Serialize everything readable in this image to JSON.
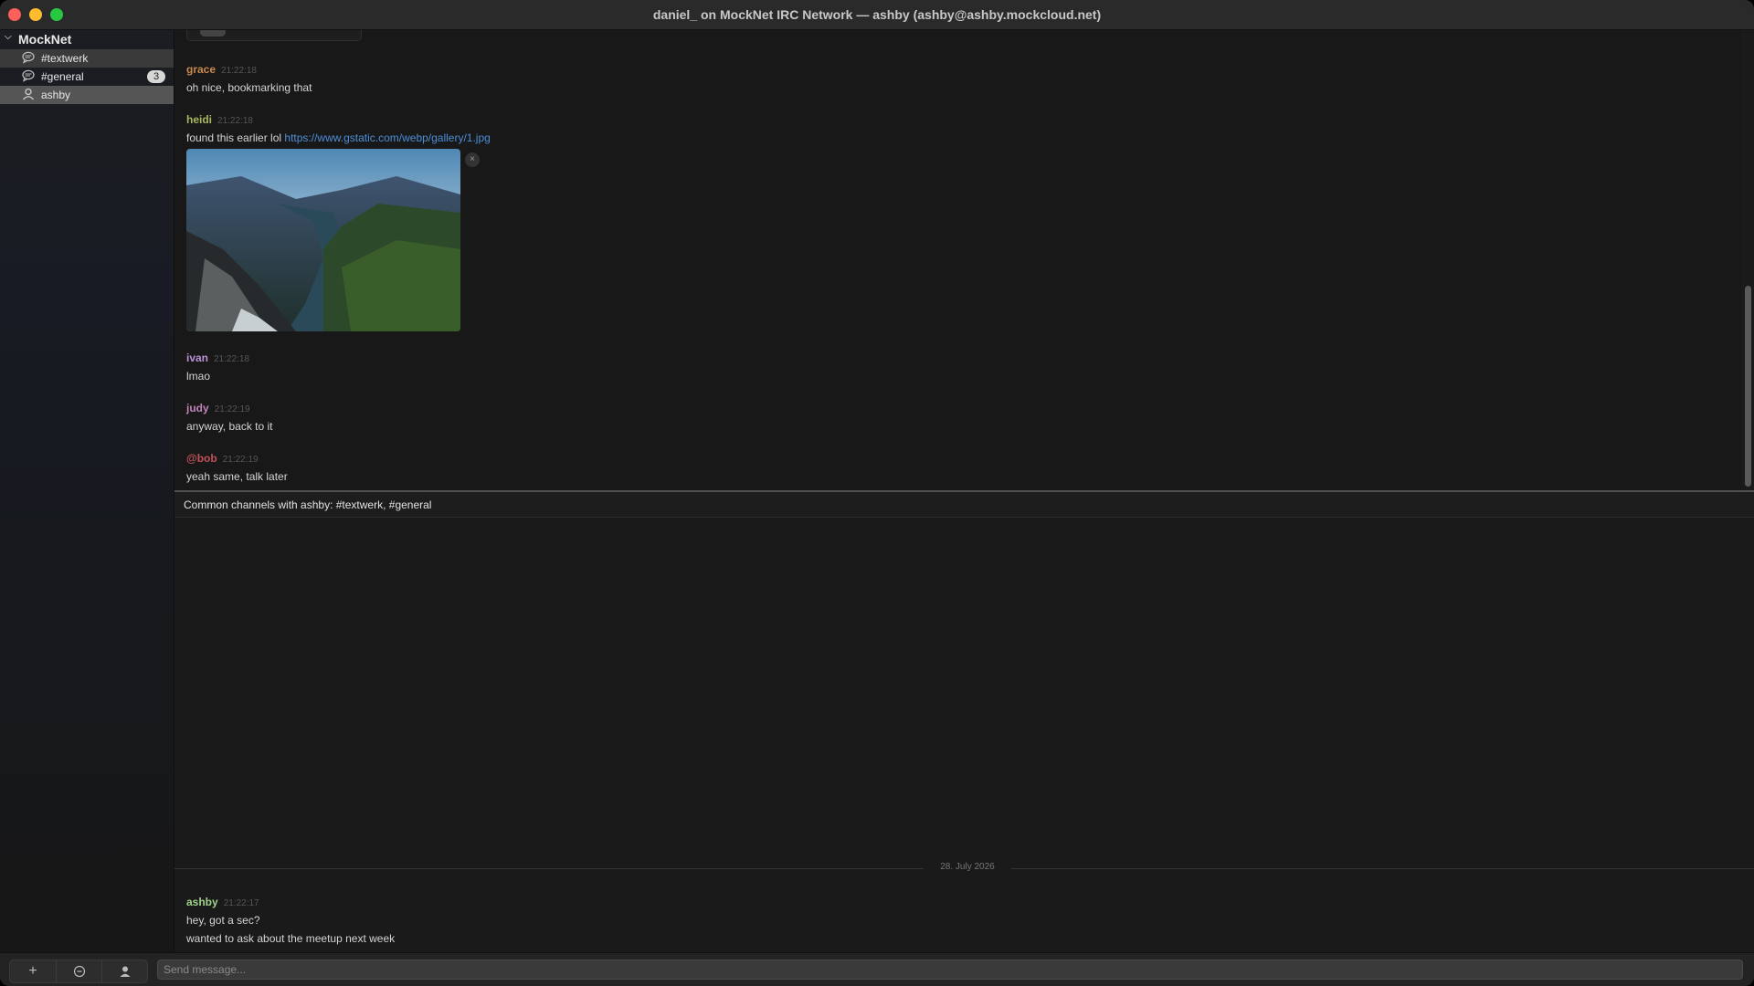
{
  "window": {
    "title": "daniel_ on MockNet IRC Network — ashby (ashby@ashby.mockcloud.net)"
  },
  "sidebar": {
    "network": "MockNet",
    "items": [
      {
        "label": "#textwerk",
        "icon": "speech-bubble-icon"
      },
      {
        "label": "#general",
        "icon": "speech-bubble-icon",
        "badge": "3"
      },
      {
        "label": "ashby",
        "icon": "person-icon"
      }
    ]
  },
  "channel_log": {
    "messages": [
      {
        "nick": "grace",
        "time": "21:22:18",
        "text": "oh nice, bookmarking that",
        "color": "#c98a4e"
      },
      {
        "nick": "heidi",
        "time": "21:22:18",
        "text": "found this earlier lol ",
        "link": "https://www.gstatic.com/webp/gallery/1.jpg",
        "color": "#a9b860"
      },
      {
        "nick": "ivan",
        "time": "21:22:18",
        "text": "lmao",
        "color": "#b991d6"
      },
      {
        "nick": "judy",
        "time": "21:22:19",
        "text": "anyway, back to it",
        "color": "#c084b8"
      },
      {
        "nick": "@bob",
        "time": "21:22:19",
        "text": "yeah same, talk later",
        "color": "#c0505a"
      }
    ],
    "image_close": "×"
  },
  "infobar": {
    "text": "Common channels with ashby: #textwerk, #general"
  },
  "query_log": {
    "date": "28. July 2026",
    "nick": "ashby",
    "time": "21:22:17",
    "color": "#9fd38a",
    "lines": [
      "hey, got a sec?",
      "wanted to ask about the meetup next week"
    ]
  },
  "bottombar": {
    "add": "+",
    "emoji": "☺",
    "user": "👤",
    "placeholder": "Send message..."
  }
}
